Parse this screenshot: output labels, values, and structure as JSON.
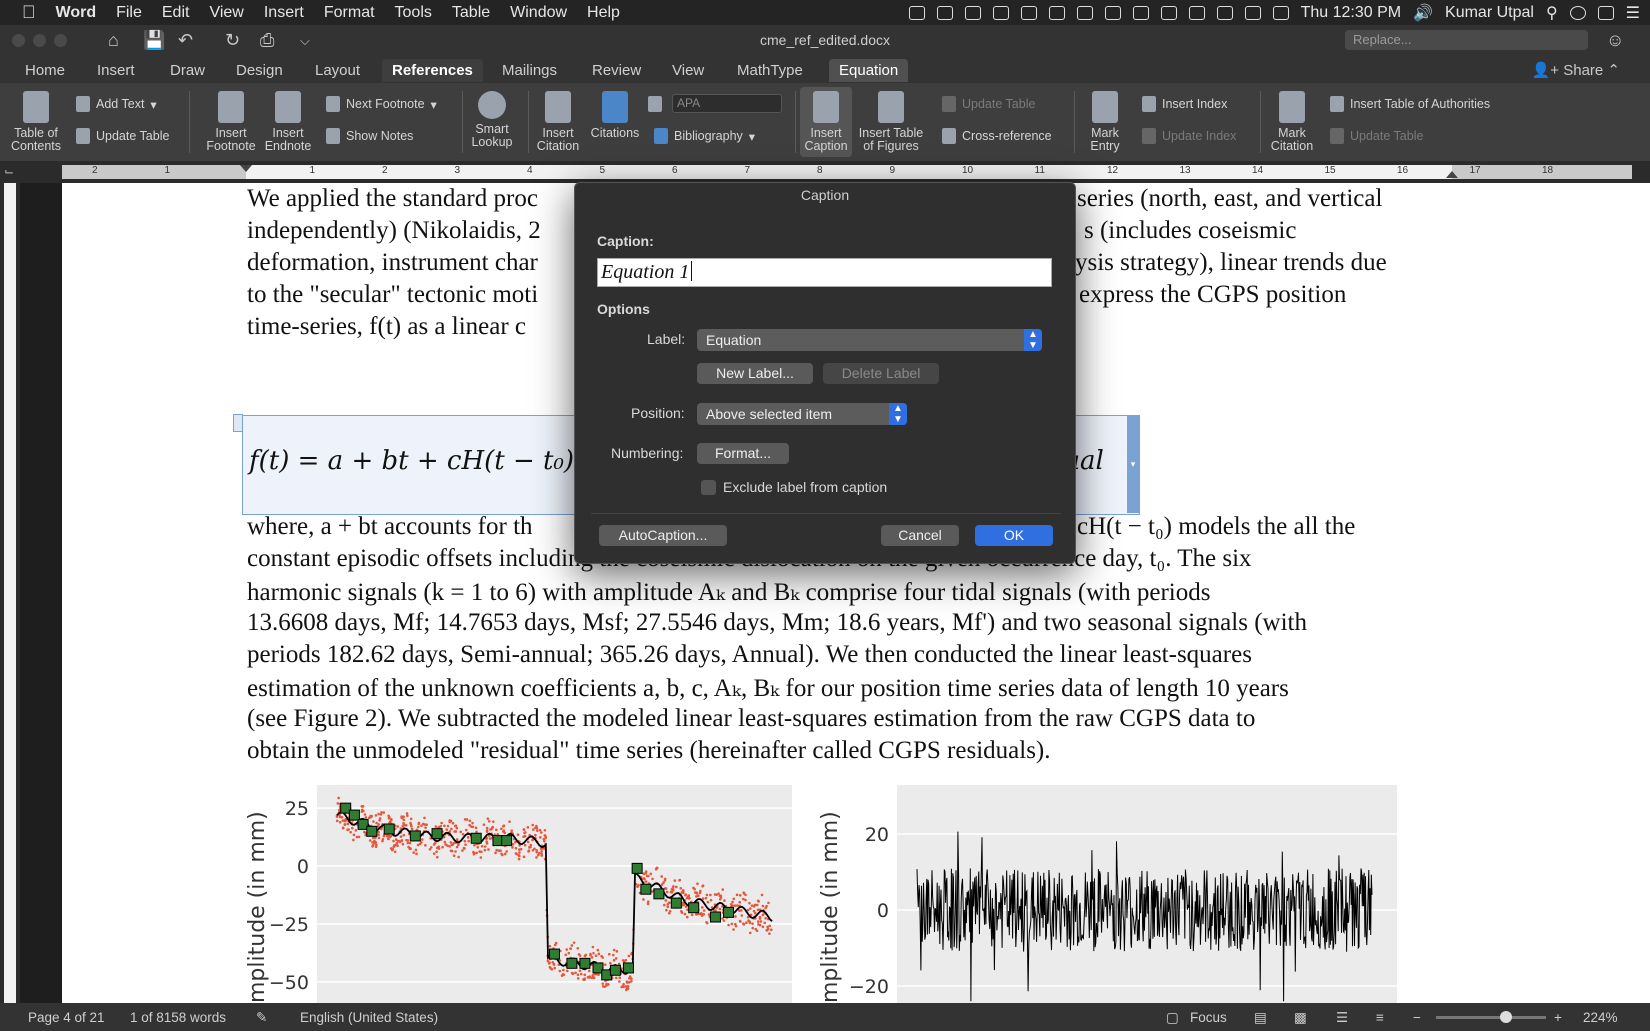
{
  "menubar": {
    "app_name": "Word",
    "items": [
      "File",
      "Edit",
      "View",
      "Insert",
      "Format",
      "Tools",
      "Table",
      "Window",
      "Help"
    ],
    "clock": "Thu 12:30 PM",
    "user": "Kumar Utpal"
  },
  "titlebar": {
    "doc_title": "cme_ref_edited.docx",
    "replace_placeholder": "Replace..."
  },
  "tabs": {
    "items": [
      "Home",
      "Insert",
      "Draw",
      "Design",
      "Layout",
      "References",
      "Mailings",
      "Review",
      "View",
      "MathType",
      "Equation"
    ],
    "active": "References",
    "share": "Share"
  },
  "ribbon": {
    "toc": "Table of Contents",
    "add_text": "Add Text",
    "update_table": "Update Table",
    "insert_footnote": "Insert Footnote",
    "insert_endnote": "Insert Endnote",
    "next_footnote": "Next Footnote",
    "show_notes": "Show Notes",
    "smart_lookup": "Smart Lookup",
    "insert_citation": "Insert Citation",
    "citations": "Citations",
    "style_value": "APA",
    "bibliography": "Bibliography",
    "insert_caption": "Insert Caption",
    "insert_table_of_figures": "Insert Table of Figures",
    "update_table_2": "Update Table",
    "cross_reference": "Cross-reference",
    "mark_entry": "Mark Entry",
    "insert_index": "Insert Index",
    "update_index": "Update Index",
    "mark_citation": "Mark Citation",
    "insert_toa": "Insert Table of Authorities",
    "update_table_3": "Update Table"
  },
  "ruler": {
    "labels": [
      "2",
      "1",
      "1",
      "2",
      "3",
      "4",
      "5",
      "6",
      "7",
      "8",
      "9",
      "10",
      "11",
      "12",
      "13",
      "14",
      "15",
      "16",
      "17",
      "18"
    ]
  },
  "document": {
    "lines_top": [
      "We applied the standard proc",
      "independently) (Nikolaidis, 2",
      "deformation, instrument char",
      "to the \"secular\" tectonic moti",
      "time-series, f(t) as a linear c"
    ],
    "lines_top_right": [
      "series (north, east, and vertical",
      "s (includes coseismic",
      "ysis strategy), linear trends due",
      "express the CGPS position"
    ],
    "equation": "f(t) = a + bt + cH(t − t₀)",
    "equation_tail": "lual",
    "line_where_left": "where, a + bt accounts for th",
    "line_where_right": "cH(t − t₀) models the all the",
    "lines_bottom": [
      "constant episodic offsets including the coseismic dislocation on the given occurrence day, t₀. The six",
      "harmonic signals (k = 1 to 6) with amplitude Aₖ and Bₖ comprise four tidal signals (with periods",
      "13.6608 days, Mf; 14.7653 days, Msf; 27.5546 days, Mm; 18.6 years, Mf') and two seasonal signals (with",
      "periods 182.62 days, Semi-annual; 365.26 days, Annual). We then conducted the linear least-squares",
      "estimation of the unknown coefficients a, b, c, Aₖ, Bₖ for our position time series data of length 10 years",
      "(see Figure 2). We subtracted the modeled linear least-squares estimation from the raw CGPS data to",
      "obtain the unmodeled \"residual\" time series (hereinafter called CGPS residuals)."
    ]
  },
  "dialog": {
    "title": "Caption",
    "caption_label": "Caption:",
    "caption_value": "Equation 1",
    "options_label": "Options",
    "label_label": "Label:",
    "label_value": "Equation",
    "new_label": "New Label...",
    "delete_label": "Delete Label",
    "position_label": "Position:",
    "position_value": "Above selected item",
    "numbering_label": "Numbering:",
    "format_button": "Format...",
    "exclude_label": "Exclude label from caption",
    "autocaption": "AutoCaption...",
    "cancel": "Cancel",
    "ok": "OK"
  },
  "chart_data": [
    {
      "type": "scatter",
      "ylabel": "mplitude (in mm)",
      "yticks": [
        "25",
        "0",
        "−25",
        "−50"
      ],
      "ylim": [
        -60,
        35
      ],
      "series": [
        {
          "kind": "points",
          "color": "#e8553a"
        },
        {
          "kind": "model",
          "color": "#000000"
        },
        {
          "kind": "markers",
          "color": "#2e7d32"
        }
      ],
      "model": [
        [
          0,
          22
        ],
        [
          10,
          16
        ],
        [
          20,
          13
        ],
        [
          30,
          12
        ],
        [
          40,
          12
        ],
        [
          48,
          10
        ],
        [
          48.5,
          -40
        ],
        [
          58,
          -43
        ],
        [
          65,
          -45
        ],
        [
          68,
          -44
        ],
        [
          68.5,
          -5
        ],
        [
          80,
          -15
        ],
        [
          100,
          -22
        ]
      ],
      "markers": [
        [
          2,
          25
        ],
        [
          4,
          22
        ],
        [
          6,
          18
        ],
        [
          8,
          15
        ],
        [
          12,
          16
        ],
        [
          18,
          13
        ],
        [
          23,
          14
        ],
        [
          32,
          12
        ],
        [
          37,
          11
        ],
        [
          39,
          11
        ],
        [
          50,
          -38
        ],
        [
          54,
          -42
        ],
        [
          57,
          -42
        ],
        [
          60,
          -44
        ],
        [
          62,
          -47
        ],
        [
          64,
          -45
        ],
        [
          67,
          -44
        ],
        [
          69,
          -1
        ],
        [
          71,
          -10
        ],
        [
          74,
          -12
        ],
        [
          78,
          -16
        ],
        [
          82,
          -18
        ],
        [
          87,
          -22
        ],
        [
          90,
          -20
        ]
      ]
    },
    {
      "type": "line",
      "ylabel": "mplitude (in mm)",
      "yticks": [
        "20",
        "0",
        "−20"
      ],
      "ylim": [
        -25,
        25
      ]
    }
  ],
  "statusbar": {
    "page": "Page 4 of 21",
    "words": "1 of 8158 words",
    "language": "English (United States)",
    "focus": "Focus",
    "zoom": "224%"
  }
}
